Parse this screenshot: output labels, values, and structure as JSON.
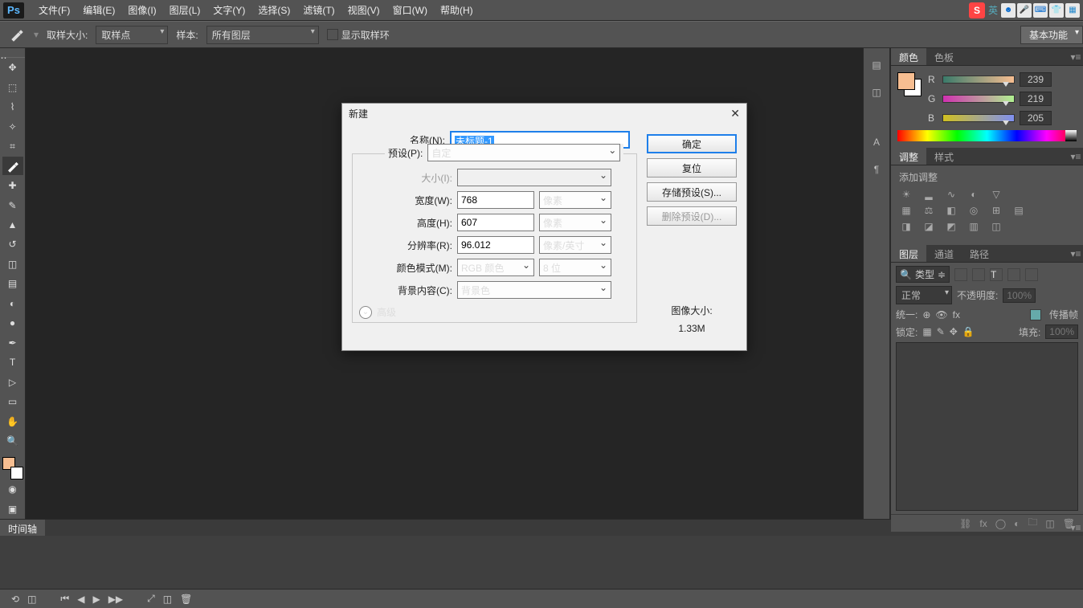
{
  "menu": {
    "items": [
      "文件(F)",
      "编辑(E)",
      "图像(I)",
      "图层(L)",
      "文字(Y)",
      "选择(S)",
      "滤镜(T)",
      "视图(V)",
      "窗口(W)",
      "帮助(H)"
    ]
  },
  "optionsBar": {
    "sampleSizeLabel": "取样大小:",
    "sampleSizeValue": "取样点",
    "sampleLabel": "样本:",
    "sampleValue": "所有图层",
    "showRingLabel": "显示取样环",
    "workspace": "基本功能"
  },
  "dialog": {
    "title": "新建",
    "nameLabel": "名称(N):",
    "nameValue": "未标题-1",
    "presetLabel": "预设(P):",
    "presetValue": "自定",
    "sizeLabel": "大小(I):",
    "sizeValue": "",
    "widthLabel": "宽度(W):",
    "widthValue": "768",
    "widthUnit": "像素",
    "heightLabel": "高度(H):",
    "heightValue": "607",
    "heightUnit": "像素",
    "resLabel": "分辨率(R):",
    "resValue": "96.012",
    "resUnit": "像素/英寸",
    "colorModeLabel": "颜色模式(M):",
    "colorModeValue": "RGB 颜色",
    "bitDepth": "8 位",
    "bgLabel": "背景内容(C):",
    "bgValue": "背景色",
    "advanced": "高级",
    "ok": "确定",
    "reset": "复位",
    "savePreset": "存储预设(S)...",
    "deletePreset": "删除预设(D)...",
    "imgSizeLabel": "图像大小:",
    "imgSizeValue": "1.33M"
  },
  "panels": {
    "colorTab": "颜色",
    "swatchTab": "色板",
    "r": "R",
    "g": "G",
    "b": "B",
    "rv": "239",
    "gv": "219",
    "bv": "205",
    "adjustTab": "调整",
    "stylesTab": "样式",
    "adjustTitle": "添加调整",
    "layersTab": "图层",
    "channelsTab": "通道",
    "pathsTab": "路径",
    "kindLabel": "类型",
    "blendValue": "正常",
    "opacityLabel": "不透明度:",
    "opacityValue": "100%",
    "unifyLabel": "统一:",
    "propagateLabel": "传播帧",
    "lockLabel": "锁定:",
    "fillLabel": "填充:",
    "fillValue": "100%"
  },
  "timeline": {
    "tab": "时间轴"
  },
  "ime": {
    "lang": "英"
  }
}
